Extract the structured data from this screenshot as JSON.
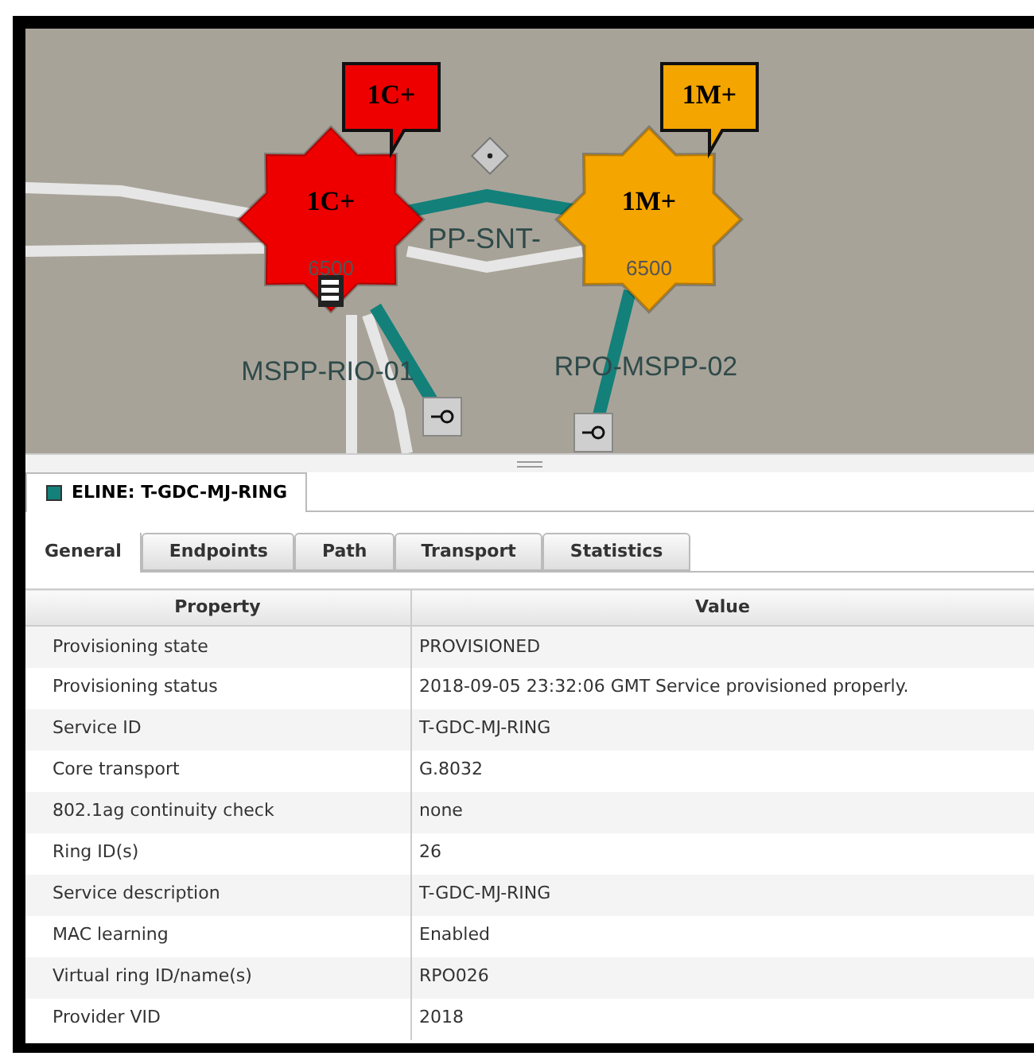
{
  "map": {
    "nodes": [
      {
        "name": "MSPP-RIO-01",
        "badge": "1C+",
        "callout": "1C+",
        "model": "6500",
        "color": "#ee0000",
        "has_stack": true
      },
      {
        "name": "RPO-MSPP-02",
        "badge": "1M+",
        "callout": "1M+",
        "model": "6500",
        "color": "#f5a500",
        "has_stack": false
      }
    ],
    "link_label": "PP-SNT-"
  },
  "service_tab": {
    "title": "ELINE: T-GDC-MJ-RING",
    "color": "#13807a"
  },
  "tabs": [
    {
      "label": "General",
      "selected": true
    },
    {
      "label": "Endpoints",
      "selected": false
    },
    {
      "label": "Path",
      "selected": false
    },
    {
      "label": "Transport",
      "selected": false
    },
    {
      "label": "Statistics",
      "selected": false
    }
  ],
  "table": {
    "columns": [
      "Property",
      "Value"
    ],
    "rows": [
      [
        "Provisioning state",
        "PROVISIONED"
      ],
      [
        "Provisioning status",
        "2018-09-05 23:32:06 GMT Service provisioned properly."
      ],
      [
        "Service ID",
        "T-GDC-MJ-RING"
      ],
      [
        "Core transport",
        "G.8032"
      ],
      [
        "802.1ag continuity check",
        "none"
      ],
      [
        "Ring ID(s)",
        "26"
      ],
      [
        "Service description",
        "T-GDC-MJ-RING"
      ],
      [
        "MAC learning",
        "Enabled"
      ],
      [
        "Virtual ring ID/name(s)",
        "RPO026"
      ],
      [
        "Provider VID",
        "2018"
      ]
    ]
  }
}
